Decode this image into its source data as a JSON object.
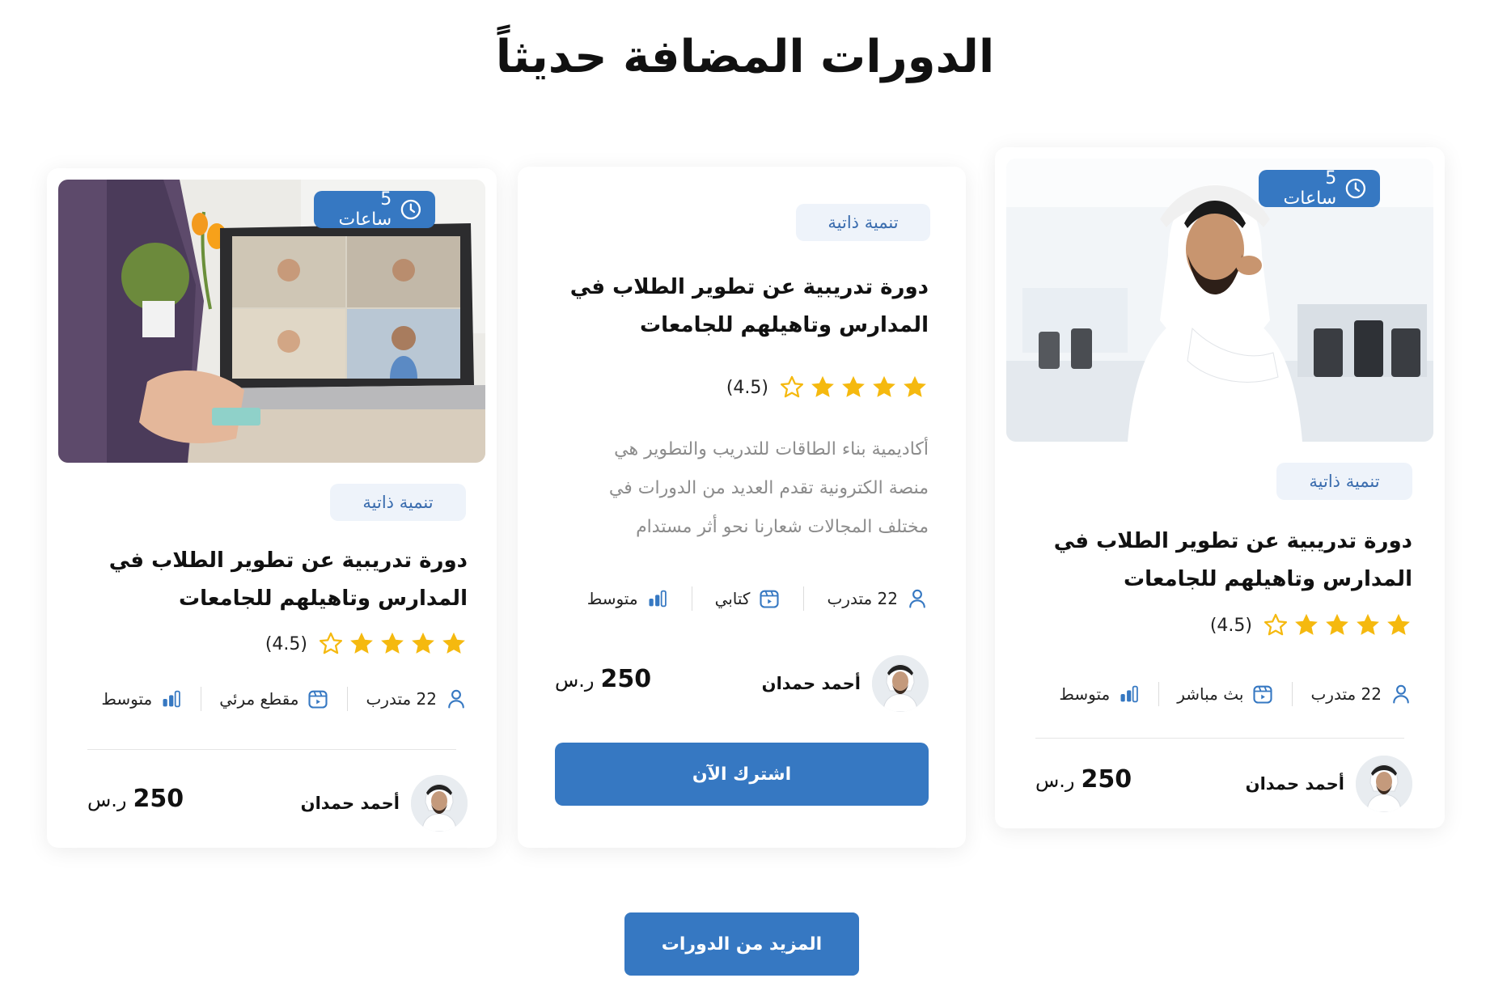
{
  "section": {
    "title": "الدورات المضافة حديثاً",
    "more_button_label": "المزيد من الدورات"
  },
  "colors": {
    "primary": "#3678c2",
    "badge_bg": "#eef3fa",
    "star": "#f5b90f"
  },
  "cards": {
    "right": {
      "duration": "5 ساعات",
      "category": "تنمية ذاتية",
      "title_line1": "دورة تدريبية عن تطوير الطلاب في",
      "title_line2": "المدارس وتاهيلهم للجامعات",
      "rating_text": "(4.5)",
      "rating": 4.5,
      "trainees": "22 متدرب",
      "format": "بث مباشر",
      "level": "متوسط",
      "instructor": "أحمد حمدان",
      "price": "250",
      "currency": "ر.س"
    },
    "middle": {
      "category": "تنمية ذاتية",
      "title_line1": "دورة تدريبية عن تطوير الطلاب في",
      "title_line2": "المدارس وتاهيلهم للجامعات",
      "rating_text": "(4.5)",
      "rating": 4.5,
      "description_line1": "أكاديمية بناء الطاقات للتدريب والتطوير هي",
      "description_line2": "منصة الكترونية تقدم العديد من الدورات في",
      "description_line3": "مختلف المجالات شعارنا نحو أثر مستدام",
      "trainees": "22 متدرب",
      "format": "كتابي",
      "level": "متوسط",
      "instructor": "أحمد حمدان",
      "price": "250",
      "currency": "ر.س",
      "subscribe_label": "اشترك الآن"
    },
    "left": {
      "duration": "5 ساعات",
      "category": "تنمية ذاتية",
      "title_line1": "دورة تدريبية عن تطوير الطلاب في",
      "title_line2": "المدارس وتاهيلهم للجامعات",
      "rating_text": "(4.5)",
      "rating": 4.5,
      "trainees": "22 متدرب",
      "format": "مقطع مرئي",
      "level": "متوسط",
      "instructor": "أحمد حمدان",
      "price": "250",
      "currency": "ر.س"
    }
  }
}
